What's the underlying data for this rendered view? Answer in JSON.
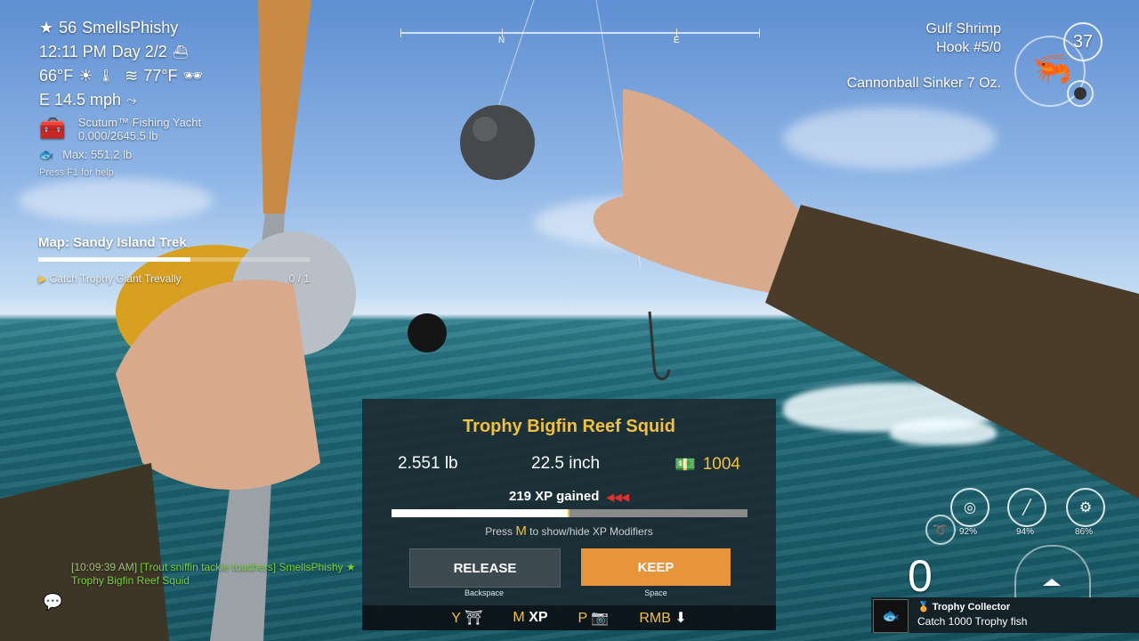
{
  "player": {
    "level": "56",
    "name": "SmellsPhishy"
  },
  "time": {
    "clock": "12:11 PM",
    "day": "Day 2/2"
  },
  "weather": {
    "air_temp": "66°F",
    "water_temp": "77°F",
    "wind": "E 14.5 mph"
  },
  "boat": {
    "name": "Scutum™ Fishing Yacht",
    "capacity": "0.000/2645.5 lb",
    "max_fish": "Max: 551.2 lb"
  },
  "help_hint": "Press F1 for help",
  "map": {
    "title": "Map: Sandy Island Trek",
    "objective": "Catch Trophy Giant Trevally",
    "progress": "0 / 1",
    "progress_fraction": 0.56
  },
  "compass": {
    "north": "N",
    "east": "E"
  },
  "tackle": {
    "bait": "Gulf Shrimp",
    "hook": "Hook #5/0",
    "sinker": "Cannonball Sinker 7 Oz.",
    "bait_count": "37"
  },
  "catch": {
    "title": "Trophy Bigfin Reef Squid",
    "weight": "2.551 lb",
    "length": "22.5 inch",
    "money": "1004",
    "xp": "219 XP gained",
    "xp_fraction": 0.495,
    "hint_prefix": "Press",
    "hint_key": "M",
    "hint_suffix": "to show/hide XP Modifiers",
    "release_label": "RELEASE",
    "release_key": "Backspace",
    "keep_label": "KEEP",
    "keep_key": "Space"
  },
  "footer": {
    "y_key": "Y",
    "m_key": "M",
    "m_label": "XP",
    "p_key": "P",
    "rmb_key": "RMB"
  },
  "chat": {
    "timestamp": "[10:09:39 AM]",
    "channel": "[Trout sniffin tackle touchers]",
    "user": "SmellsPhishy",
    "message": "Trophy Bigfin Reef Squid"
  },
  "gear": {
    "line": "92%",
    "rod": "94%",
    "reel": "86%"
  },
  "speed": "0",
  "achievement": {
    "title": "Trophy Collector",
    "desc": "Catch 1000 Trophy fish"
  },
  "colors": {
    "gold": "#f0c040",
    "keep": "#e8943a",
    "release": "#3c4a50",
    "chat_green": "#78d03c"
  }
}
